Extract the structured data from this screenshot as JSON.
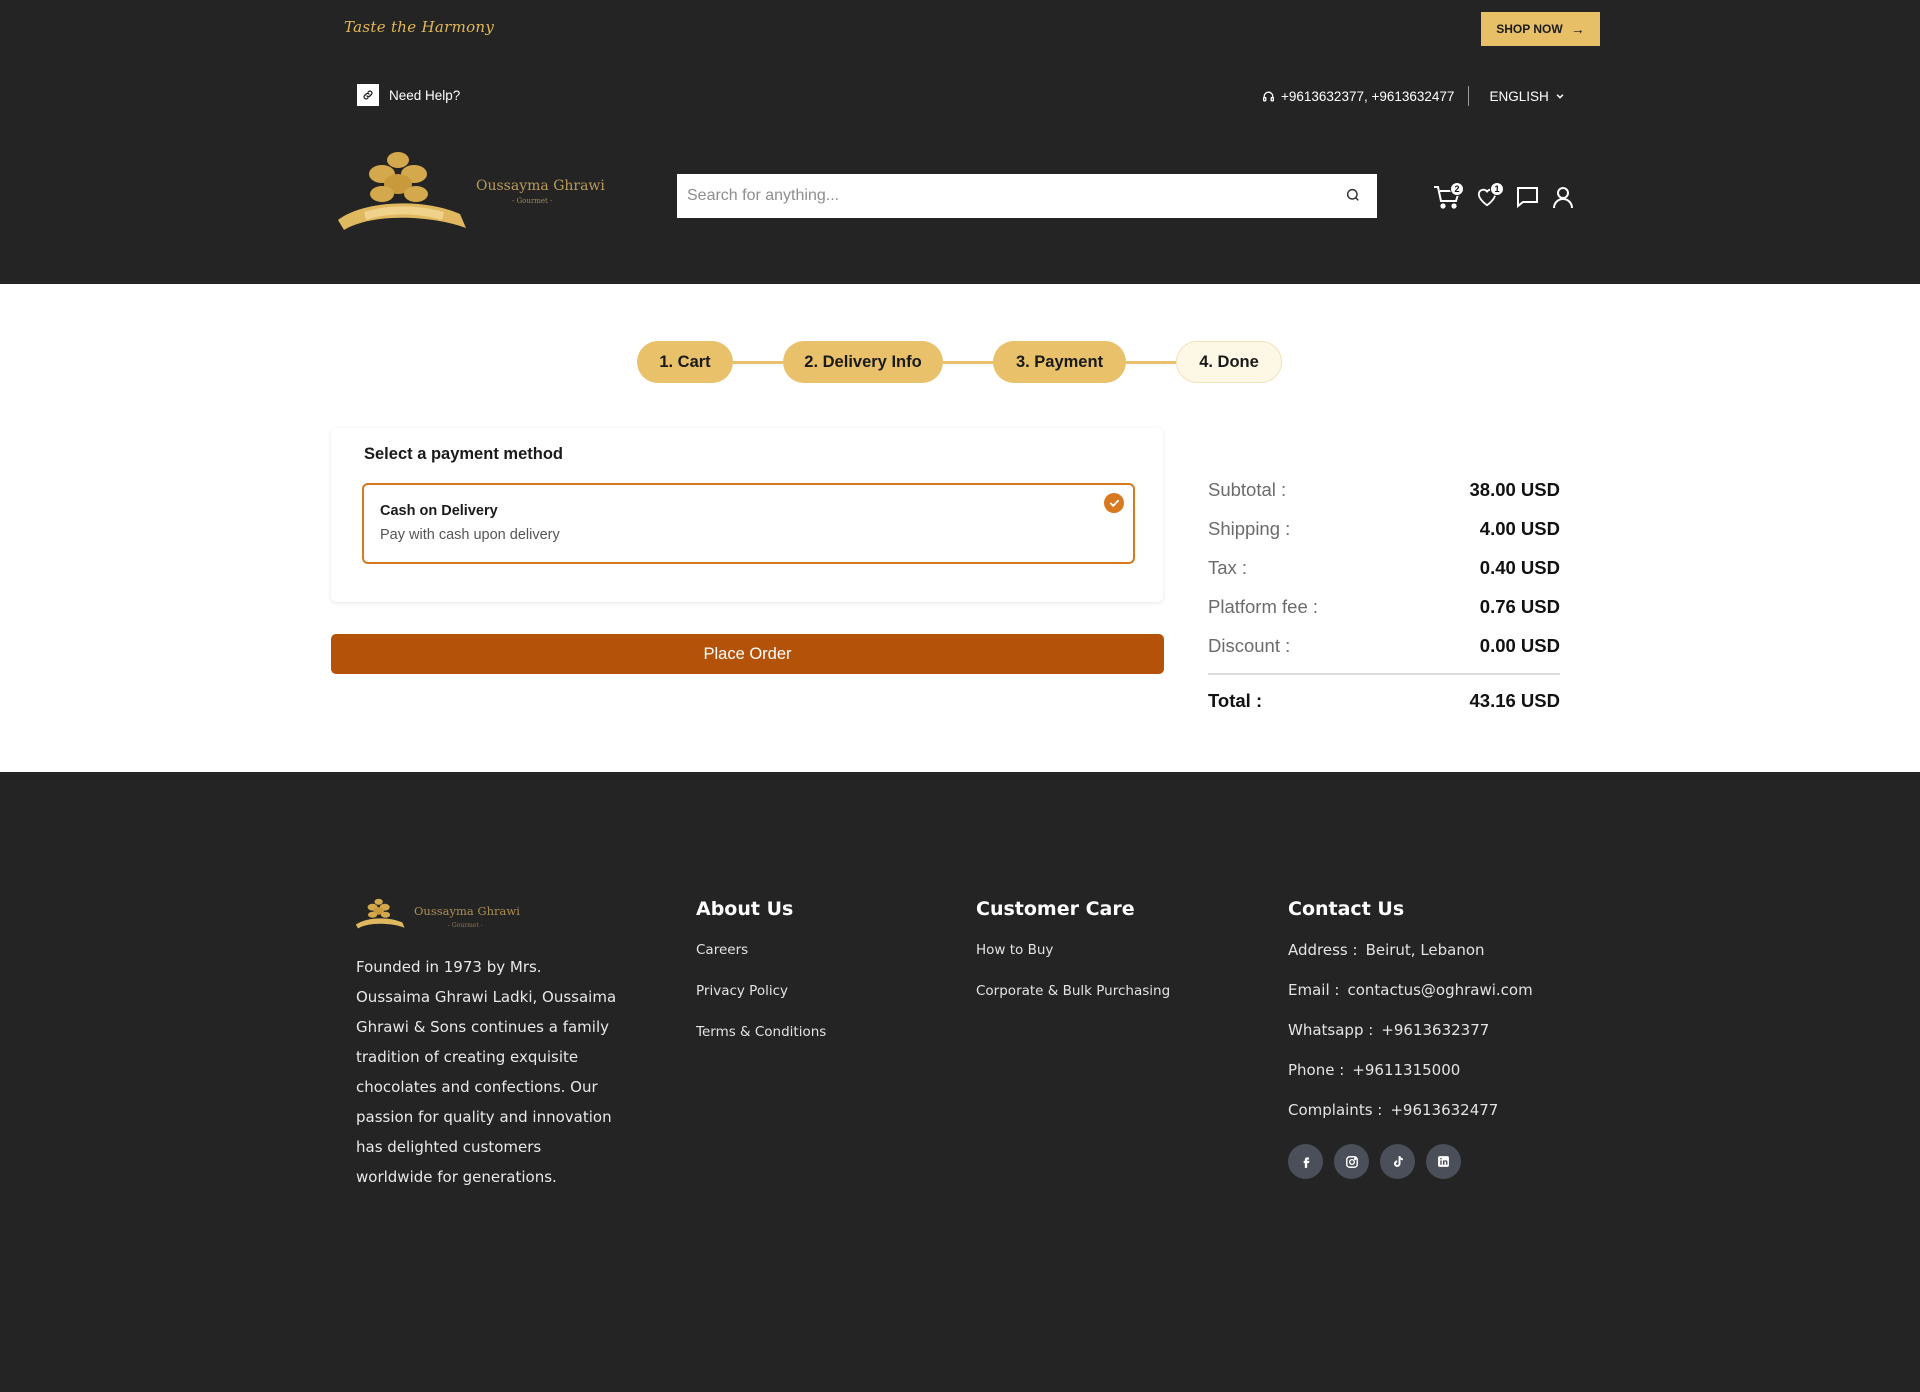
{
  "header": {
    "tagline": "Taste the Harmony",
    "shop_now": "SHOP NOW",
    "help_label": "Need Help?",
    "phones": "+9613632377, +9613632477",
    "language": "ENGLISH",
    "logo": {
      "name": "Oussayma Ghrawi",
      "sub": "- Gourmet -"
    },
    "search_placeholder": "Search for anything...",
    "cart_count": "2",
    "wishlist_count": "1"
  },
  "stepper": {
    "steps": [
      "1. Cart",
      "2. Delivery Info",
      "3. Payment",
      "4. Done"
    ]
  },
  "payment": {
    "title": "Select a payment method",
    "option_title": "Cash on Delivery",
    "option_desc": "Pay with cash upon delivery",
    "place_order": "Place Order"
  },
  "summary": {
    "rows": [
      {
        "label": "Subtotal :",
        "value": "38.00 USD"
      },
      {
        "label": "Shipping :",
        "value": "4.00 USD"
      },
      {
        "label": "Tax :",
        "value": "0.40 USD"
      },
      {
        "label": "Platform fee :",
        "value": "0.76 USD"
      },
      {
        "label": "Discount :",
        "value": "0.00 USD"
      }
    ],
    "total_label": "Total :",
    "total_value": "43.16 USD"
  },
  "footer": {
    "logo": {
      "name": "Oussayma Ghrawi",
      "sub": "- Gourmet -"
    },
    "about_text": "Founded in 1973 by Mrs. Oussaima Ghrawi Ladki, Oussaima Ghrawi & Sons continues a family tradition of creating exquisite chocolates and confections. Our passion for quality and innovation has delighted customers worldwide for generations.",
    "about_us": {
      "title": "About Us",
      "links": [
        "Careers",
        "Privacy Policy",
        "Terms & Conditions"
      ]
    },
    "customer_care": {
      "title": "Customer Care",
      "links": [
        "How to Buy",
        "Corporate & Bulk Purchasing"
      ]
    },
    "contact": {
      "title": "Contact Us",
      "rows": [
        {
          "k": "Address :",
          "v": "Beirut, Lebanon"
        },
        {
          "k": "Email :",
          "v": "contactus@oghrawi.com"
        },
        {
          "k": "Whatsapp :",
          "v": "+9613632377"
        },
        {
          "k": "Phone :",
          "v": "+9611315000"
        },
        {
          "k": "Complaints :",
          "v": "+9613632477"
        }
      ]
    }
  },
  "colors": {
    "header_bg": "#242424",
    "gold": "#e6bf66",
    "accent_orange": "#d8781f",
    "place_order_bg": "#b5520a"
  }
}
